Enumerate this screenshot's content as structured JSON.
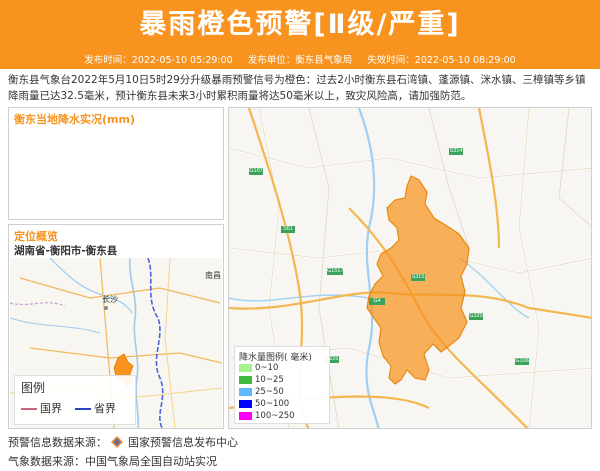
{
  "header": {
    "title": "暴雨橙色预警[Ⅱ级/严重]",
    "issue_time": "发布时间：2022-05-10 05:29:00",
    "issuer": "发布单位：衡东县气象局",
    "expire_time": "失效时间：2022-05-10 08:29:00",
    "color": "#f7931e"
  },
  "description": "衡东县气象台2022年5月10日5时29分升级暴雨预警信号为橙色：过去2小时衡东县石湾镇、蓬源镇、洣水镇、三樟镇等乡镇降雨量已达32.5毫米，预计衡东县未来3小时累积雨量将达50毫米以上，致灾风险高，请加强防范。",
  "rain_panel": {
    "title": "衡东当地降水实况(mm)"
  },
  "location_panel": {
    "title": "定位概览",
    "path": "湖南省-衡阳市-衡东县",
    "city_labels": [
      "长沙",
      "南昌"
    ],
    "legend": {
      "title": "图例",
      "national_border": "国界",
      "provincial_border": "省界"
    }
  },
  "main_map": {
    "road_labels": [
      "G1517",
      "S315",
      "G320",
      "S61",
      "G4",
      "G106",
      "S225",
      "S314",
      "G107"
    ],
    "rain_legend": {
      "title": "降水量图例( 毫米)",
      "items": [
        {
          "label": "0~10",
          "color": "#a6f28f"
        },
        {
          "label": "10~25",
          "color": "#3dba3d"
        },
        {
          "label": "25~50",
          "color": "#61b8ff"
        },
        {
          "label": "50~100",
          "color": "#0000ff"
        },
        {
          "label": "100~250",
          "color": "#fa00fa"
        }
      ]
    },
    "warning_fill": "#f7931e"
  },
  "footer": {
    "source": "预警信息数据来源：",
    "source_org": "国家预警信息发布中心",
    "weather_source": "气象数据来源：中国气象局全国自动站实况"
  }
}
